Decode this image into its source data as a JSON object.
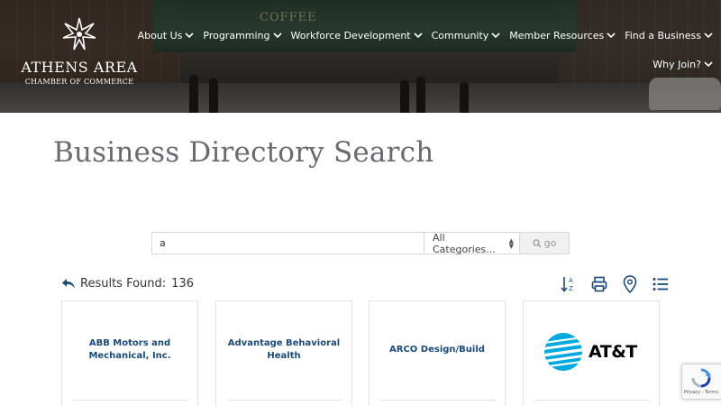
{
  "header": {
    "logo_line1": "Athens Area",
    "logo_line2": "Chamber of Commerce",
    "storefront_sign": "COFFEE",
    "nav": [
      {
        "label": "About Us"
      },
      {
        "label": "Programming"
      },
      {
        "label": "Workforce Development"
      },
      {
        "label": "Community"
      },
      {
        "label": "Member Resources"
      },
      {
        "label": "Find a Business"
      }
    ],
    "nav_row2": [
      {
        "label": "Why Join?"
      }
    ]
  },
  "page": {
    "title": "Business Directory Search"
  },
  "search": {
    "value": "a",
    "category_selected": "All Categories...",
    "go_label": "go"
  },
  "results": {
    "label": "Results Found:",
    "count": "136"
  },
  "cards": [
    {
      "name": "ABB Motors and Mechanical, Inc."
    },
    {
      "name": "Advantage Behavioral Health"
    },
    {
      "name": "ARCO Design/Build"
    },
    {
      "name": "AT&T",
      "logo": "att-globe-icon"
    }
  ],
  "recaptcha": {
    "links": "Privacy - Terms"
  },
  "colors": {
    "nav_text": "#ffffff",
    "title": "#6a6a72",
    "card_name": "#1a4a7a",
    "att_blue": "#00a8e0"
  }
}
